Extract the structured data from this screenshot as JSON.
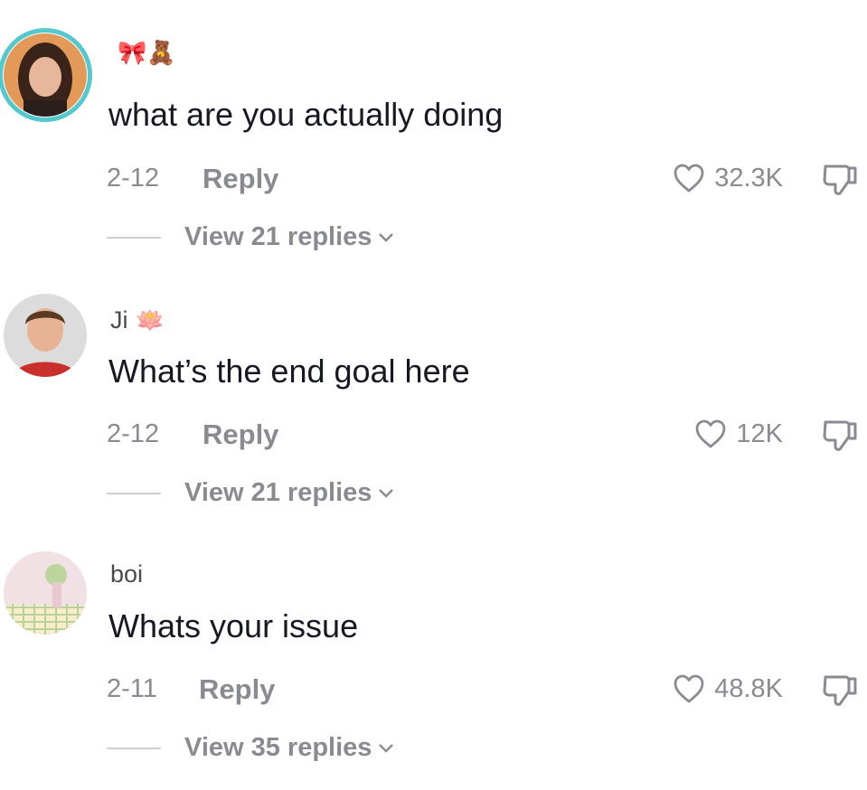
{
  "comments": [
    {
      "username": "",
      "username_emoji": "🎀🧸",
      "text": "what are you actually doing",
      "date": "2-12",
      "reply_label": "Reply",
      "likes": "32.3K",
      "view_replies": "View 21 replies",
      "has_story_ring": true,
      "ring_color": "#53c8cf"
    },
    {
      "username": "Ji",
      "username_emoji": "🪷",
      "text": "What’s the end goal here",
      "date": "2-12",
      "reply_label": "Reply",
      "likes": "12K",
      "view_replies": "View 21 replies",
      "has_story_ring": false
    },
    {
      "username": "boi",
      "username_emoji": "",
      "text": "Whats your issue",
      "date": "2-11",
      "reply_label": "Reply",
      "likes": "48.8K",
      "view_replies": "View 35 replies",
      "has_story_ring": false
    }
  ],
  "icons": {
    "like": "heart-outline-icon",
    "dislike": "thumbs-down-outline-icon",
    "expand": "chevron-down-icon"
  },
  "colors": {
    "secondary_text": "#8a8b91",
    "primary_text": "#161823",
    "story_ring": "#53c8cf"
  }
}
